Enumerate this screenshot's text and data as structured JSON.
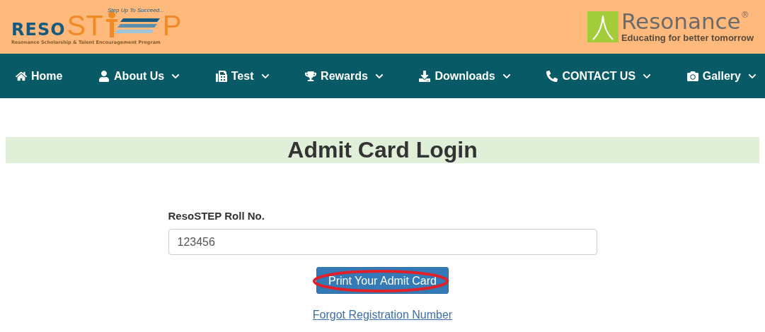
{
  "header": {
    "logo": {
      "part_1": "RESO",
      "part_2": "ST",
      "part_3": "P",
      "tagline": "Step Up To Succeed...",
      "subtitle": "Resonance Scholarship & Talent Encouragement Program"
    },
    "partner": {
      "name": "Resonance",
      "mark": "®",
      "slogan": "Educating for better tomorrow"
    }
  },
  "nav": [
    {
      "label": "Home",
      "dropdown": false
    },
    {
      "label": "About Us",
      "dropdown": true
    },
    {
      "label": "Test",
      "dropdown": true
    },
    {
      "label": "Rewards",
      "dropdown": true
    },
    {
      "label": "Downloads",
      "dropdown": true
    },
    {
      "label": "CONTACT US",
      "dropdown": true
    },
    {
      "label": "Gallery",
      "dropdown": true
    }
  ],
  "title": "Admit Card Login",
  "form": {
    "label": "ResoSTEP Roll No.",
    "value": "123456",
    "button": "Print Your Admit Card",
    "button_circled": true,
    "link": "Forgot Registration Number"
  }
}
